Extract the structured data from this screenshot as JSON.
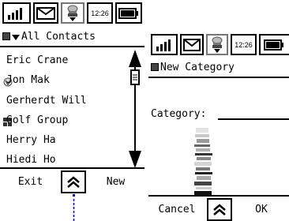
{
  "screen1": {
    "status": {
      "time": "12:26"
    },
    "title": "All Contacts",
    "contacts": [
      {
        "name": "Eric Crane",
        "icon": ""
      },
      {
        "name": "Jon Mak",
        "icon": "contact-group-badge-icon"
      },
      {
        "name": "Gerherdt Will",
        "icon": ""
      },
      {
        "name": "Golf Group",
        "icon": "group-grid-icon"
      },
      {
        "name": "Herry Ha",
        "icon": ""
      },
      {
        "name": "Hiedi Ho",
        "icon": ""
      }
    ],
    "buttons": {
      "exit": "Exit",
      "new": "New"
    }
  },
  "screen2": {
    "status": {
      "time": "12:26"
    },
    "title": "New Category",
    "category_label": "Category:",
    "category_value": "",
    "buttons": {
      "cancel": "Cancel",
      "ok": "OK"
    }
  },
  "colors": {
    "connector": "#0000cc",
    "frame": "#000000",
    "background": "#ffffff"
  }
}
